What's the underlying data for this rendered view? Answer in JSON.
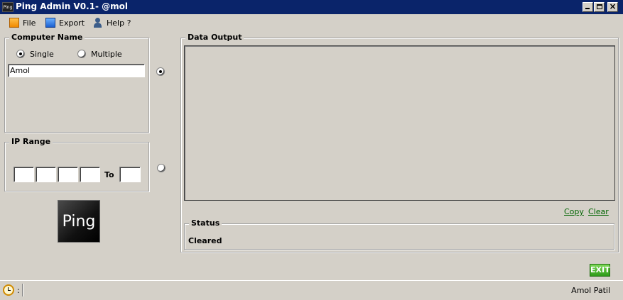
{
  "window": {
    "title": "Ping Admin V0.1- @mol",
    "app_icon_text": "Ping"
  },
  "menu": [
    {
      "label": "File"
    },
    {
      "label": "Export"
    },
    {
      "label": "Help ?"
    }
  ],
  "computer_name": {
    "group_title": "Computer Name",
    "single_label": "Single",
    "multiple_label": "Multiple",
    "mode_selected": "Single",
    "name_value": "Amol",
    "source_selected": true
  },
  "ip_range": {
    "group_title": "IP Range",
    "octets": [
      "",
      "",
      "",
      ""
    ],
    "to_label": "To",
    "end_value": "",
    "source_selected": false
  },
  "ping_button": {
    "label": "Ping"
  },
  "data_output": {
    "group_title": "Data Output",
    "content": ""
  },
  "actions": {
    "copy_label": "Copy",
    "clear_label": "Clear"
  },
  "status": {
    "group_title": "Status",
    "value": "Cleared"
  },
  "exit_button": {
    "label": "EXIT"
  },
  "statusbar": {
    "clock_text": ":",
    "author": "Amol Patil"
  }
}
